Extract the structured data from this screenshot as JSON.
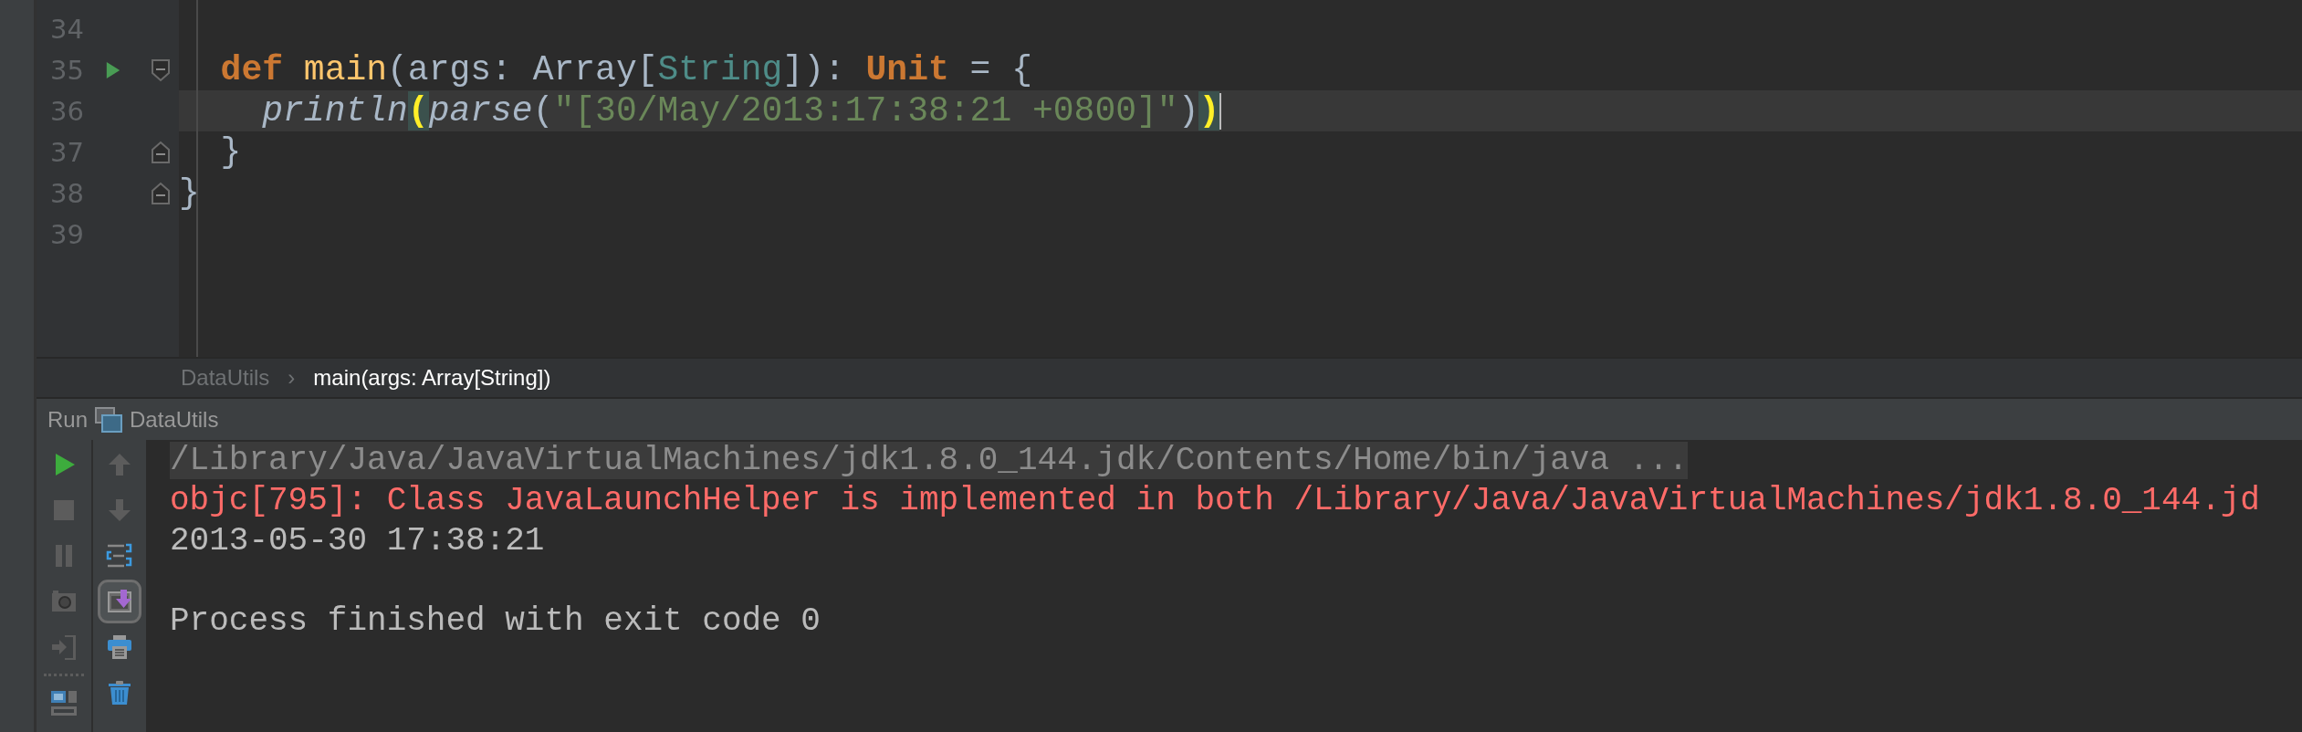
{
  "editor": {
    "lines": [
      {
        "number": "34",
        "current": false
      },
      {
        "number": "35",
        "current": false,
        "run_marker": true,
        "fold_open": true,
        "tokens": [
          {
            "kind": "keyword",
            "text": "  def"
          },
          {
            "kind": "function",
            "text": " main"
          },
          {
            "kind": "plain",
            "text": "(args: Array["
          },
          {
            "kind": "type",
            "text": "String"
          },
          {
            "kind": "plain",
            "text": "]): "
          },
          {
            "kind": "keyword",
            "text": "Unit"
          },
          {
            "kind": "plain",
            "text": " = {"
          }
        ]
      },
      {
        "number": "36",
        "current": true,
        "caret": true,
        "tokens": [
          {
            "kind": "call",
            "text": "    println"
          },
          {
            "kind": "brace-match",
            "text": "("
          },
          {
            "kind": "call",
            "text": "parse"
          },
          {
            "kind": "plain",
            "text": "("
          },
          {
            "kind": "string",
            "text": "\"[30/May/2013:17:38:21 +0800]\""
          },
          {
            "kind": "plain",
            "text": ")"
          },
          {
            "kind": "brace-match",
            "text": ")"
          }
        ]
      },
      {
        "number": "37",
        "current": false,
        "fold_close": true,
        "tokens": [
          {
            "kind": "plain",
            "text": "  }"
          }
        ]
      },
      {
        "number": "38",
        "current": false,
        "fold_close": true,
        "tokens": [
          {
            "kind": "plain",
            "text": "}"
          }
        ]
      },
      {
        "number": "39",
        "current": false
      }
    ]
  },
  "breadcrumbs": {
    "separator": "›",
    "items": [
      {
        "label": "DataUtils",
        "selected": false
      },
      {
        "label": "main(args: Array[String])",
        "selected": true
      }
    ]
  },
  "run_panel": {
    "label": "Run",
    "config": "DataUtils",
    "left_tools": [
      {
        "kind": "run",
        "disabled": false
      },
      {
        "kind": "stop",
        "disabled": true
      },
      {
        "kind": "pause",
        "disabled": true
      },
      {
        "kind": "dump",
        "disabled": true
      },
      {
        "kind": "exit",
        "disabled": true
      },
      {
        "kind": "separator"
      },
      {
        "kind": "layout",
        "disabled": false
      }
    ],
    "right_tools": [
      {
        "kind": "up",
        "disabled": true
      },
      {
        "kind": "down",
        "disabled": true
      },
      {
        "kind": "wrap",
        "disabled": false
      },
      {
        "kind": "scroll-end",
        "disabled": false,
        "on": true
      },
      {
        "kind": "print",
        "disabled": false
      },
      {
        "kind": "trash",
        "disabled": false
      }
    ],
    "console": [
      {
        "kind": "command",
        "text": "/Library/Java/JavaVirtualMachines/jdk1.8.0_144.jdk/Contents/Home/bin/java ..."
      },
      {
        "kind": "error",
        "text": "objc[795]: Class JavaLaunchHelper is implemented in both /Library/Java/JavaVirtualMachines/jdk1.8.0_144.jd"
      },
      {
        "kind": "output",
        "text": "2013-05-30 17:38:21"
      },
      {
        "kind": "blank"
      },
      {
        "kind": "output",
        "text": "Process finished with exit code 0"
      }
    ]
  }
}
